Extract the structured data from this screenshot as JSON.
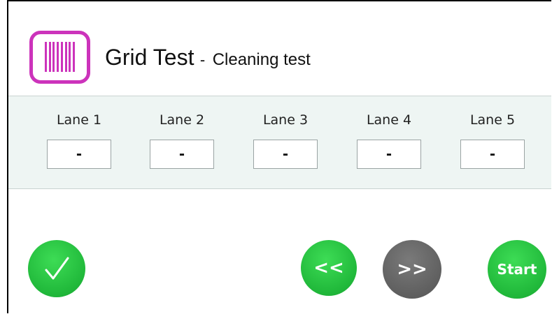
{
  "header": {
    "title": "Grid Test",
    "separator": "-",
    "subtitle": "Cleaning test",
    "logo_icon": "grid-bars-icon",
    "logo_color": "#cc33bb"
  },
  "lanes": [
    {
      "label": "Lane 1",
      "value": "-"
    },
    {
      "label": "Lane 2",
      "value": "-"
    },
    {
      "label": "Lane 3",
      "value": "-"
    },
    {
      "label": "Lane 4",
      "value": "-"
    },
    {
      "label": "Lane 5",
      "value": "-"
    }
  ],
  "buttons": {
    "confirm_icon": "checkmark-icon",
    "prev_label": "<<",
    "next_label": ">>",
    "start_label": "Start",
    "green": "#22bb3a",
    "gray": "#5f5f5f"
  }
}
